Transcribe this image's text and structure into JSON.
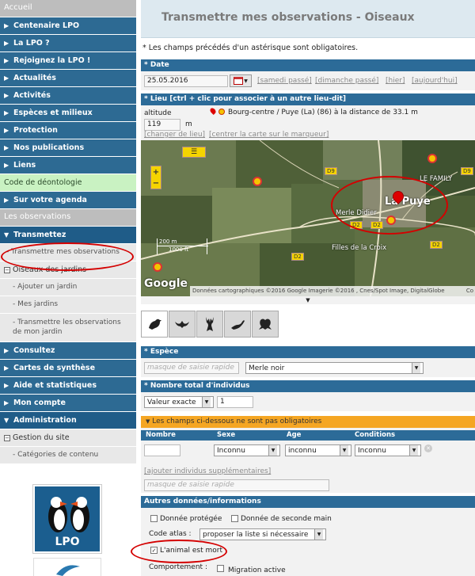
{
  "sidebar": {
    "header": "Accueil",
    "items": [
      {
        "label": "Centenaire LPO"
      },
      {
        "label": "La LPO ?"
      },
      {
        "label": "Rejoignez la LPO !"
      },
      {
        "label": "Actualités"
      },
      {
        "label": "Activités"
      },
      {
        "label": "Espèces et milieux"
      },
      {
        "label": "Protection"
      },
      {
        "label": "Nos publications"
      },
      {
        "label": "Liens"
      }
    ],
    "code_deontologie": "Code de déontologie",
    "agenda": "Sur votre agenda",
    "observations_header": "Les observations",
    "transmettez": "Transmettez",
    "transmettre": "- Transmettre mes observations",
    "oiseaux_jardins": "Oiseaux des jardins",
    "ajouter_jardin": "- Ajouter un jardin",
    "mes_jardins": "- Mes jardins",
    "transmettre_jardin": "- Transmettre les observations de mon jardin",
    "bottom_items": [
      {
        "label": "Consultez"
      },
      {
        "label": "Cartes de synthèse"
      },
      {
        "label": "Aide et statistiques"
      },
      {
        "label": "Mon compte"
      },
      {
        "label": "Administration"
      }
    ],
    "gestion_site": "Gestion du site",
    "categories": "- Catégories de contenu",
    "logo_text": "LPO"
  },
  "page": {
    "title": "Transmettre mes observations - Oiseaux",
    "required_note": "* Les champs précédés d'un astérisque sont obligatoires."
  },
  "date": {
    "header": "* Date",
    "value": "25.05.2016",
    "links": [
      "[samedi passé]",
      "[dimanche passé]",
      "[hier]",
      "[aujourd'hui]"
    ]
  },
  "lieu": {
    "header": "* Lieu [ctrl + clic pour associer à un autre lieu-dit]",
    "altitude_label": "altitude",
    "altitude_value": "119",
    "altitude_unit": "m",
    "location_text": "Bourg-centre / Puye (La) (86) à la distance de 33.1 m",
    "change_link": "[changer de lieu]",
    "center_link": "[centrer la carte sur le marqueur]"
  },
  "map": {
    "labels": {
      "town": "La Puye",
      "merle": "Merle Didier",
      "family": "LE FAMILY",
      "filles": "Filles de la Croix",
      "d9a": "D9",
      "d9b": "D9",
      "d2a": "D2",
      "d2b": "D2",
      "d2c": "D2",
      "d2d": "D2"
    },
    "scale_m": "200 m",
    "scale_ft": "1000 ft",
    "google": "Google",
    "attribution": "Données cartographiques ©2016 Google Imagerie ©2016 , Cnes/Spot Image, DigitalGlobe",
    "attribution_tail": "Co",
    "zoom_in": "+",
    "zoom_out": "−"
  },
  "animal_tabs": [
    "bird-icon",
    "bat-icon",
    "deer-icon",
    "lizard-icon",
    "frog-icon"
  ],
  "espece": {
    "header": "* Espèce",
    "quick_placeholder": "masque de saisie rapide",
    "selected": "Merle noir"
  },
  "nombre": {
    "header": "* Nombre total d'individus",
    "type": "Valeur exacte",
    "value": "1"
  },
  "optional": {
    "header": "Les champs ci-dessous ne sont pas obligatoires",
    "columns": [
      "Nombre",
      "Sexe",
      "Age",
      "Conditions"
    ],
    "sexe": "Inconnu",
    "age": "inconnu",
    "conditions": "Inconnu",
    "add_link": "[ajouter individus supplémentaires]",
    "quick_placeholder": "masque de saisie rapide"
  },
  "autres": {
    "header": "Autres données/informations",
    "protected": "Donnée protégée",
    "second_hand": "Donnée de seconde main",
    "code_atlas_label": "Code atlas :",
    "code_atlas_value": "proposer la liste si nécessaire",
    "dead": "L'animal est mort",
    "comportement_label": "Comportement :",
    "migration": "Migration active"
  },
  "colors": {
    "nav_blue": "#2d6a93",
    "section_blue": "#2c6b98",
    "orange": "#f5a623",
    "annotation_red": "#d40000",
    "green_item": "#c9f2c2"
  }
}
